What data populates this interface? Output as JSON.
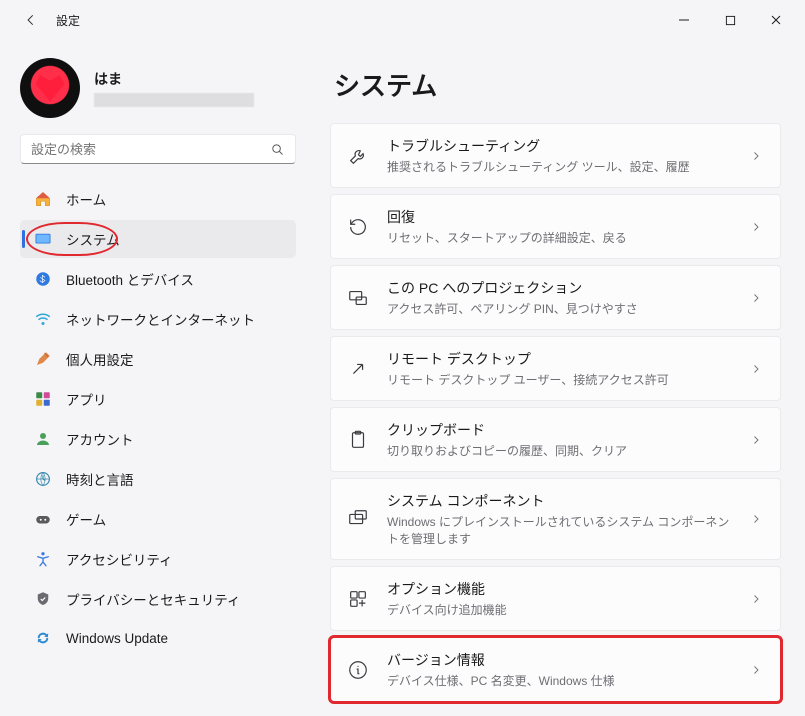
{
  "window": {
    "title": "設定"
  },
  "user": {
    "name": "はま"
  },
  "search": {
    "placeholder": "設定の検索"
  },
  "nav": {
    "items": [
      {
        "label": "ホーム"
      },
      {
        "label": "システム"
      },
      {
        "label": "Bluetooth とデバイス"
      },
      {
        "label": "ネットワークとインターネット"
      },
      {
        "label": "個人用設定"
      },
      {
        "label": "アプリ"
      },
      {
        "label": "アカウント"
      },
      {
        "label": "時刻と言語"
      },
      {
        "label": "ゲーム"
      },
      {
        "label": "アクセシビリティ"
      },
      {
        "label": "プライバシーとセキュリティ"
      },
      {
        "label": "Windows Update"
      }
    ]
  },
  "main": {
    "title": "システム",
    "cards": [
      {
        "title": "トラブルシューティング",
        "sub": "推奨されるトラブルシューティング ツール、設定、履歴"
      },
      {
        "title": "回復",
        "sub": "リセット、スタートアップの詳細設定、戻る"
      },
      {
        "title": "この PC へのプロジェクション",
        "sub": "アクセス許可、ペアリング PIN、見つけやすさ"
      },
      {
        "title": "リモート デスクトップ",
        "sub": "リモート デスクトップ ユーザー、接続アクセス許可"
      },
      {
        "title": "クリップボード",
        "sub": "切り取りおよびコピーの履歴、同期、クリア"
      },
      {
        "title": "システム コンポーネント",
        "sub": "Windows にプレインストールされているシステム コンポーネントを管理します"
      },
      {
        "title": "オプション機能",
        "sub": "デバイス向け追加機能"
      },
      {
        "title": "バージョン情報",
        "sub": "デバイス仕様、PC 名変更、Windows 仕様"
      }
    ]
  }
}
